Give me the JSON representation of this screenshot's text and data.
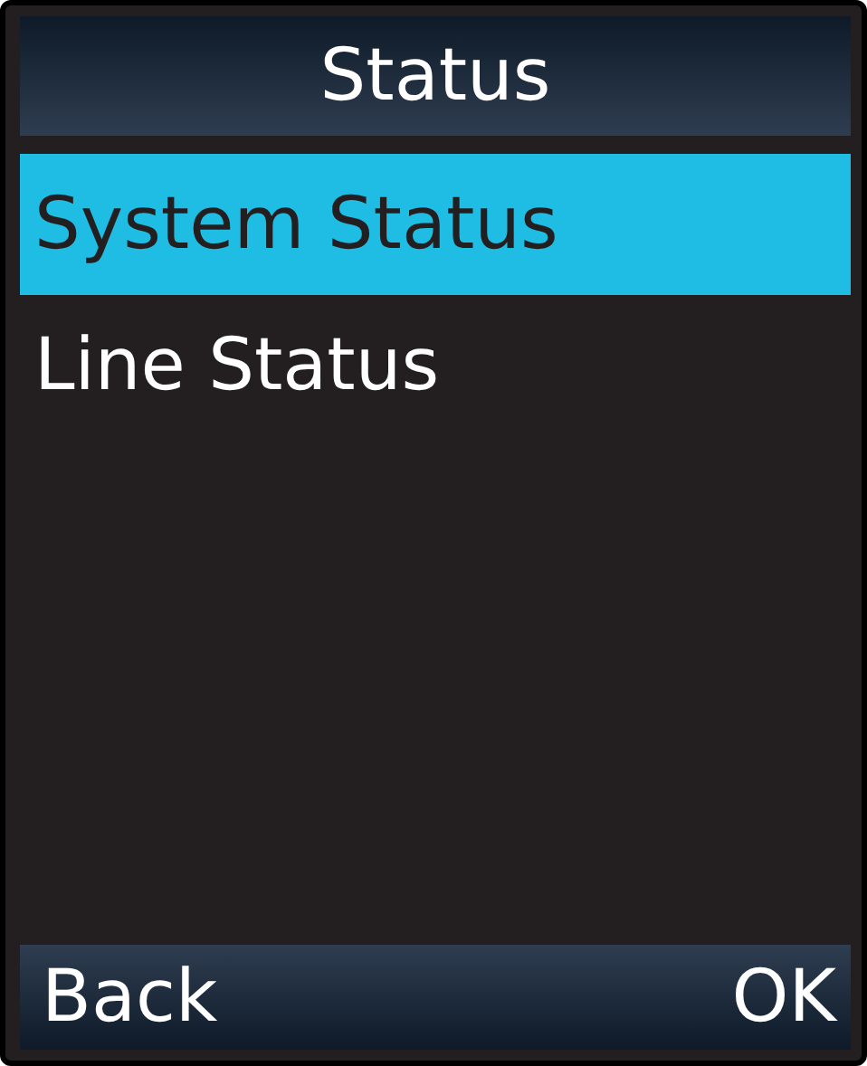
{
  "title": "Status",
  "items": [
    {
      "label": "System Status",
      "selected": true
    },
    {
      "label": "Line Status",
      "selected": false
    }
  ],
  "softkeys": {
    "left": "Back",
    "right": "OK"
  }
}
